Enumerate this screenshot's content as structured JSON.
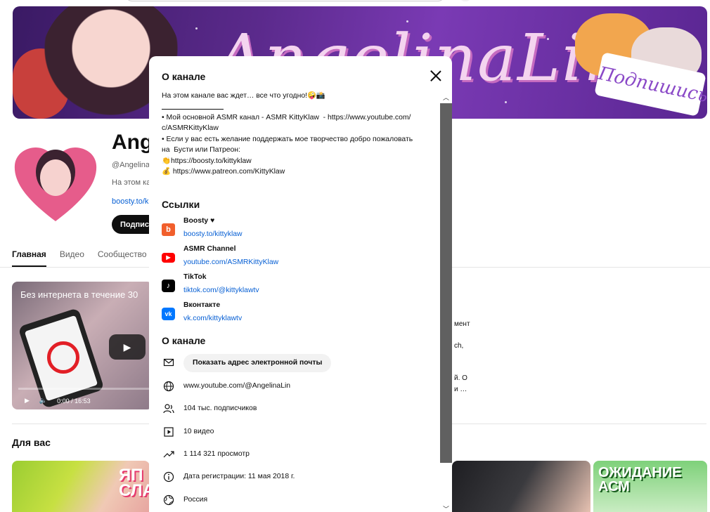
{
  "colors": {
    "accent_link": "#065fd4",
    "boosty": "#f15f2c",
    "youtube": "#ff0000",
    "tiktok": "#000000",
    "vk": "#0077ff"
  },
  "banner": {
    "title": "AngelinaLin~",
    "sign": "Подпишись"
  },
  "channel": {
    "name": "Ange",
    "handle": "@AngelinaL",
    "description": "На этом ка",
    "link": "boosty.to/k",
    "subscribe_label": "Подпис"
  },
  "tabs": [
    "Главная",
    "Видео",
    "Сообщество"
  ],
  "featured_video": {
    "title": "Без интернета в течение 30",
    "time": "0:00 / 16:53",
    "side_lines": [
      "мент",
      "ch,",
      "й. О",
      "и …"
    ]
  },
  "for_you": {
    "title": "Для вас",
    "thumb1_label": "ЯП\nСЛА",
    "thumb4_label": "ОЖИДАНИЕ\nАСМ"
  },
  "modal": {
    "title": "О канале",
    "description": [
      "На этом канале вас ждет… все что угодно!🤪📸",
      "• Мой основной ASMR канал - ASMR KittyKlaw  - https://www.youtube.com/\nc/ASMRKittyKlaw",
      "• Если у вас есть желание поддержать мое творчество добро пожаловать\nна  Бусти или Патреон:",
      "👏https://boosty.to/kittyklaw",
      "💰 https://www.patreon.com/KittyKlaw"
    ],
    "links_title": "Ссылки",
    "links": [
      {
        "icon": "boosty-icon",
        "name": "Boosty ♥",
        "url": "boosty.to/kittyklaw"
      },
      {
        "icon": "youtube-icon",
        "name": "ASMR Channel",
        "url": "youtube.com/ASMRKittyKlaw"
      },
      {
        "icon": "tiktok-icon",
        "name": "TikTok",
        "url": "tiktok.com/@kittyklawtv"
      },
      {
        "icon": "vk-icon",
        "name": "Вконтакте",
        "url": "vk.com/kittyklawtv"
      }
    ],
    "about_title": "О канале",
    "about": {
      "email_button": "Показать адрес электронной почты",
      "url": "www.youtube.com/@AngelinaLin",
      "subscribers": "104 тыс. подписчиков",
      "videos": "10 видео",
      "views": "1 114 321 просмотр",
      "joined": "Дата регистрации: 11 мая 2018 г.",
      "country": "Россия"
    }
  }
}
